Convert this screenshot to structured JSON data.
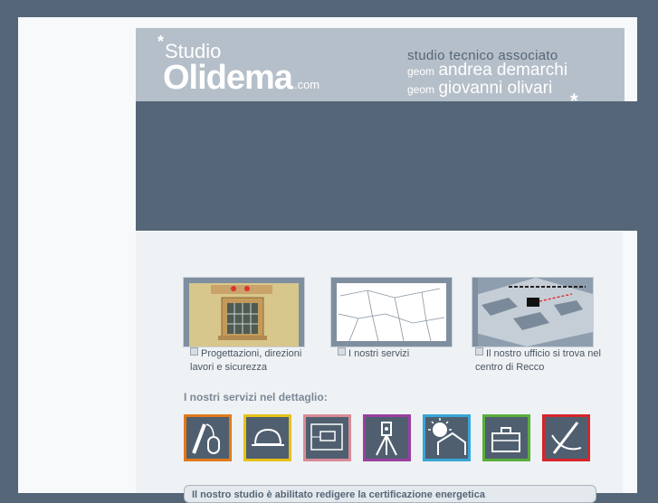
{
  "header": {
    "logo_star": "*",
    "logo_studio": "Studio",
    "logo_main": "Olidema",
    "logo_domain": ".com",
    "tagline": "studio tecnico associato",
    "names": [
      {
        "prefix": "geom",
        "name": "andrea demarchi"
      },
      {
        "prefix": "geom",
        "name": "giovanni olivari"
      }
    ],
    "star": "*"
  },
  "features": [
    {
      "caption": "Progettazioni, direzioni lavori e sicurezza"
    },
    {
      "caption": "I nostri servizi"
    },
    {
      "caption": "Il nostro ufficio si trova nel centro di Recco"
    }
  ],
  "services_title": "I nostri servizi nel dettaglio:",
  "service_icons": [
    {
      "icon": "pencil-mouse-icon",
      "color": "#e07a1c"
    },
    {
      "icon": "helmet-icon",
      "color": "#e6c21a"
    },
    {
      "icon": "floorplan-icon",
      "color": "#d98a96"
    },
    {
      "icon": "theodolite-icon",
      "color": "#9a3fa0"
    },
    {
      "icon": "sun-house-icon",
      "color": "#37a6d8"
    },
    {
      "icon": "briefcase-icon",
      "color": "#5aae3a"
    },
    {
      "icon": "compass-icon",
      "color": "#d8232a"
    }
  ],
  "notice": "Il nostro studio è abilitato redigere la certificazione energetica"
}
